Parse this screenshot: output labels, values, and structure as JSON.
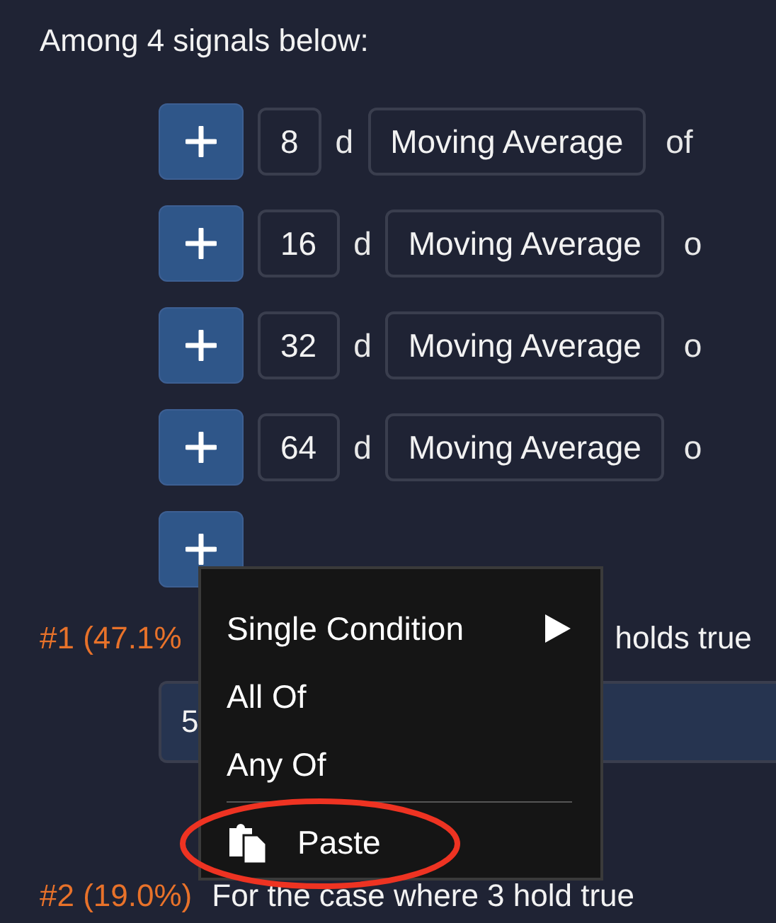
{
  "heading": "Among 4 signals below:",
  "signals": [
    {
      "period": "8",
      "unit": "d",
      "indicator": "Moving Average",
      "suffix": "of"
    },
    {
      "period": "16",
      "unit": "d",
      "indicator": "Moving Average",
      "suffix": "o"
    },
    {
      "period": "32",
      "unit": "d",
      "indicator": "Moving Average",
      "suffix": "o"
    },
    {
      "period": "64",
      "unit": "d",
      "indicator": "Moving Average",
      "suffix": "o"
    }
  ],
  "cases": [
    {
      "label": "#1 (47.1%",
      "text": "holds true",
      "field_value": "5"
    },
    {
      "label": "#2 (19.0%)",
      "text": "For the case where 3 hold true"
    }
  ],
  "context_menu": {
    "items": [
      {
        "kind": "submenu",
        "label": "Single Condition"
      },
      {
        "kind": "item",
        "label": "All Of"
      },
      {
        "kind": "item",
        "label": "Any Of"
      },
      {
        "kind": "divider"
      },
      {
        "kind": "paste",
        "label": "Paste",
        "highlighted": true
      }
    ]
  }
}
